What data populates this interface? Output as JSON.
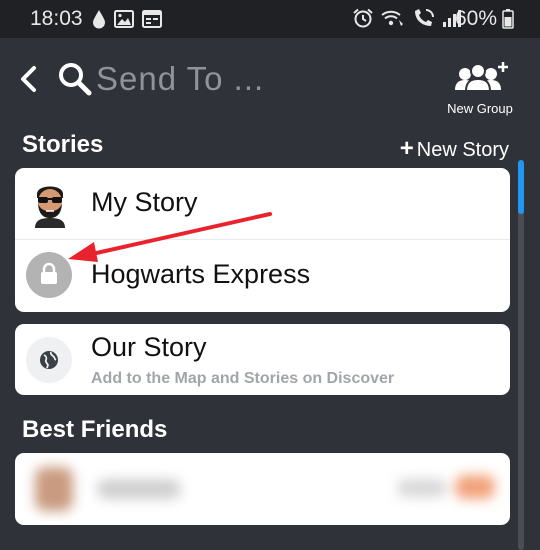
{
  "status_bar": {
    "time": "18:03",
    "battery": "60%"
  },
  "header": {
    "search_placeholder": "Send To ...",
    "new_group_label": "New Group"
  },
  "stories": {
    "title": "Stories",
    "new_story_label": "New Story",
    "items": [
      {
        "label": "My Story",
        "icon": "bitmoji-avatar"
      },
      {
        "label": "Hogwarts Express",
        "icon": "lock-icon"
      }
    ],
    "our_story": {
      "label": "Our Story",
      "subtitle": "Add to the Map and Stories on Discover",
      "icon": "globe-icon"
    }
  },
  "best_friends": {
    "title": "Best Friends"
  },
  "colors": {
    "background": "#2f3238",
    "status_bar": "#1f2125",
    "card": "#ffffff",
    "annotation_arrow": "#e8232e",
    "scroll_thumb": "#2196f3"
  }
}
